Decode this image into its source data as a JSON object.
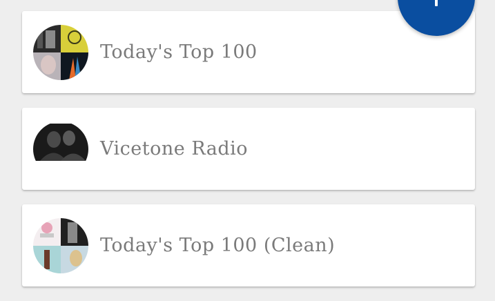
{
  "stations": [
    {
      "title": "Today's Top 100"
    },
    {
      "title": "Vicetone Radio"
    },
    {
      "title": "Today's Top 100 (Clean)"
    }
  ],
  "fab": {
    "icon": "add-icon",
    "color": "#0a4ea0"
  },
  "colors": {
    "background": "#eeeeee",
    "card": "#ffffff",
    "title_text": "#7a7a7a"
  }
}
